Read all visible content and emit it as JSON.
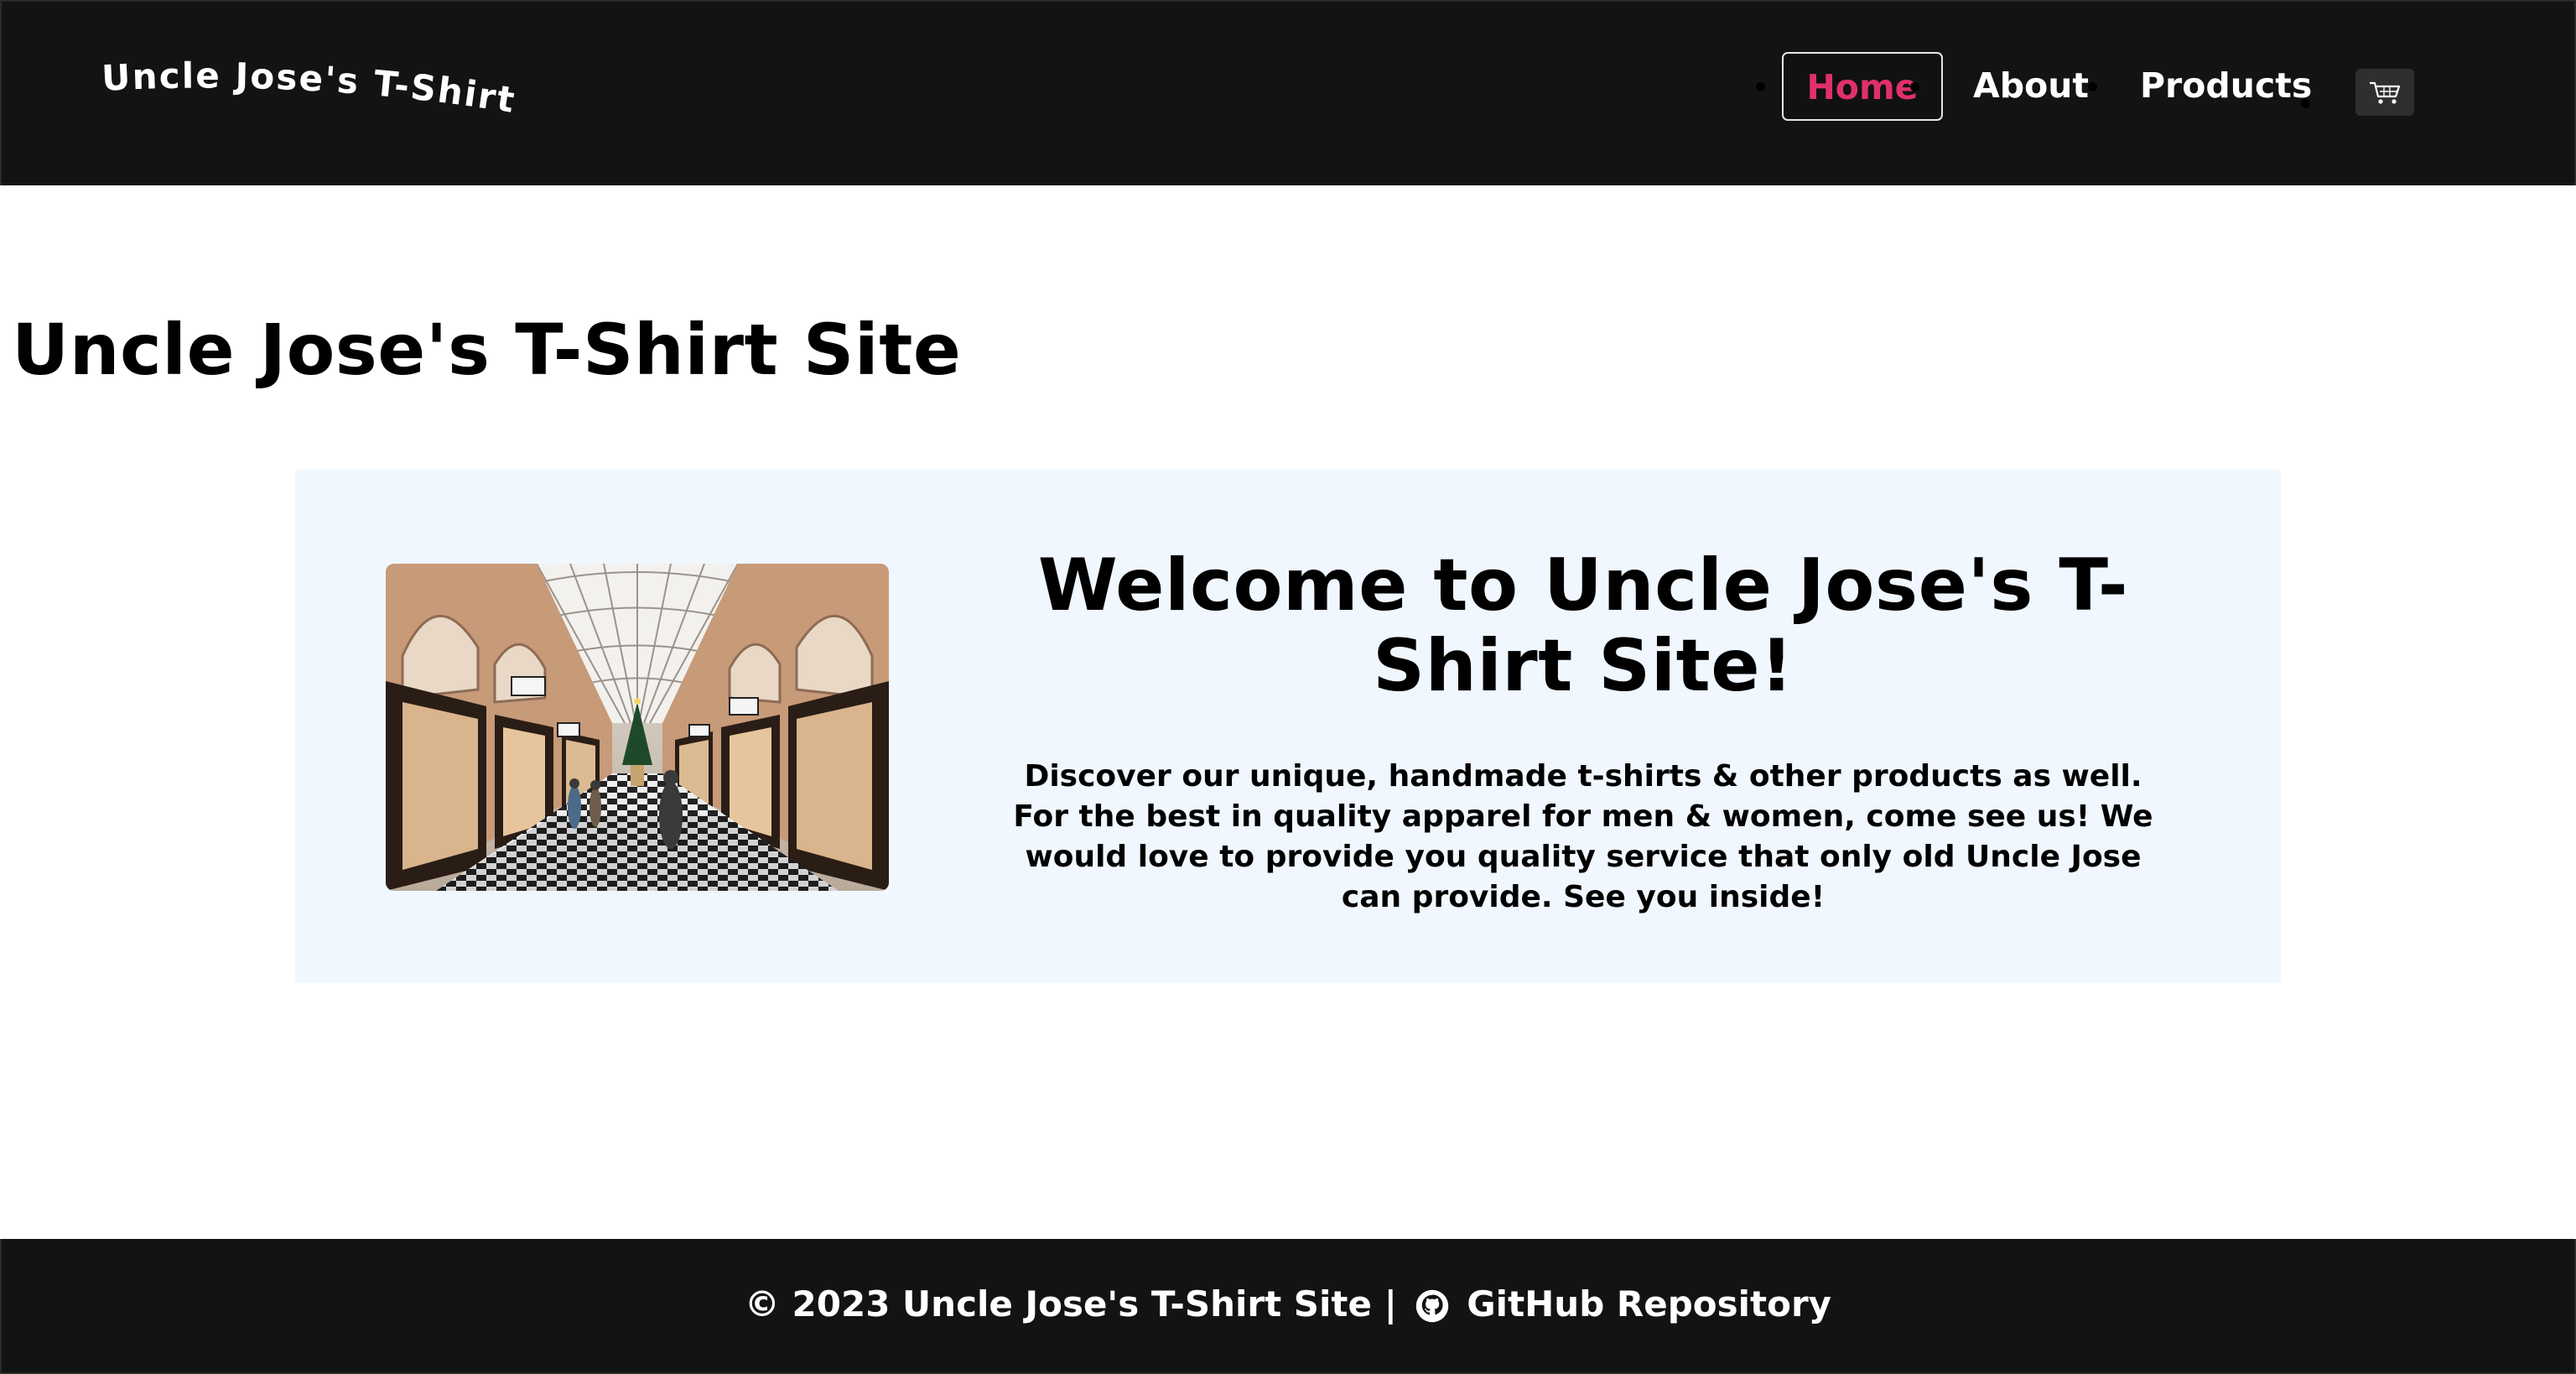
{
  "header": {
    "logo_text": "Uncle Jose's T-Shirt",
    "nav": [
      {
        "label": "Home",
        "active": true
      },
      {
        "label": "About",
        "active": false
      },
      {
        "label": "Products",
        "active": false
      }
    ],
    "cart_icon": "shopping-cart-icon",
    "active_color": "#e0306c",
    "background": "#121313"
  },
  "main": {
    "page_title": "Uncle Jose's T-Shirt Site",
    "hero": {
      "image_alt": "shopping arcade with christmas tree",
      "heading": "Welcome to Uncle Jose's T-Shirt Site!",
      "body": "Discover our unique, handmade t-shirts & other products as well. For the best in quality apparel for men & women, come see us! We would love to provide you quality service that only old Uncle Jose can provide. See you inside!",
      "background": "#f0f7ff"
    }
  },
  "footer": {
    "copyright": "© 2023 Uncle Jose's T-Shirt Site |",
    "github_icon": "github-icon",
    "github_label": "GitHub Repository"
  }
}
